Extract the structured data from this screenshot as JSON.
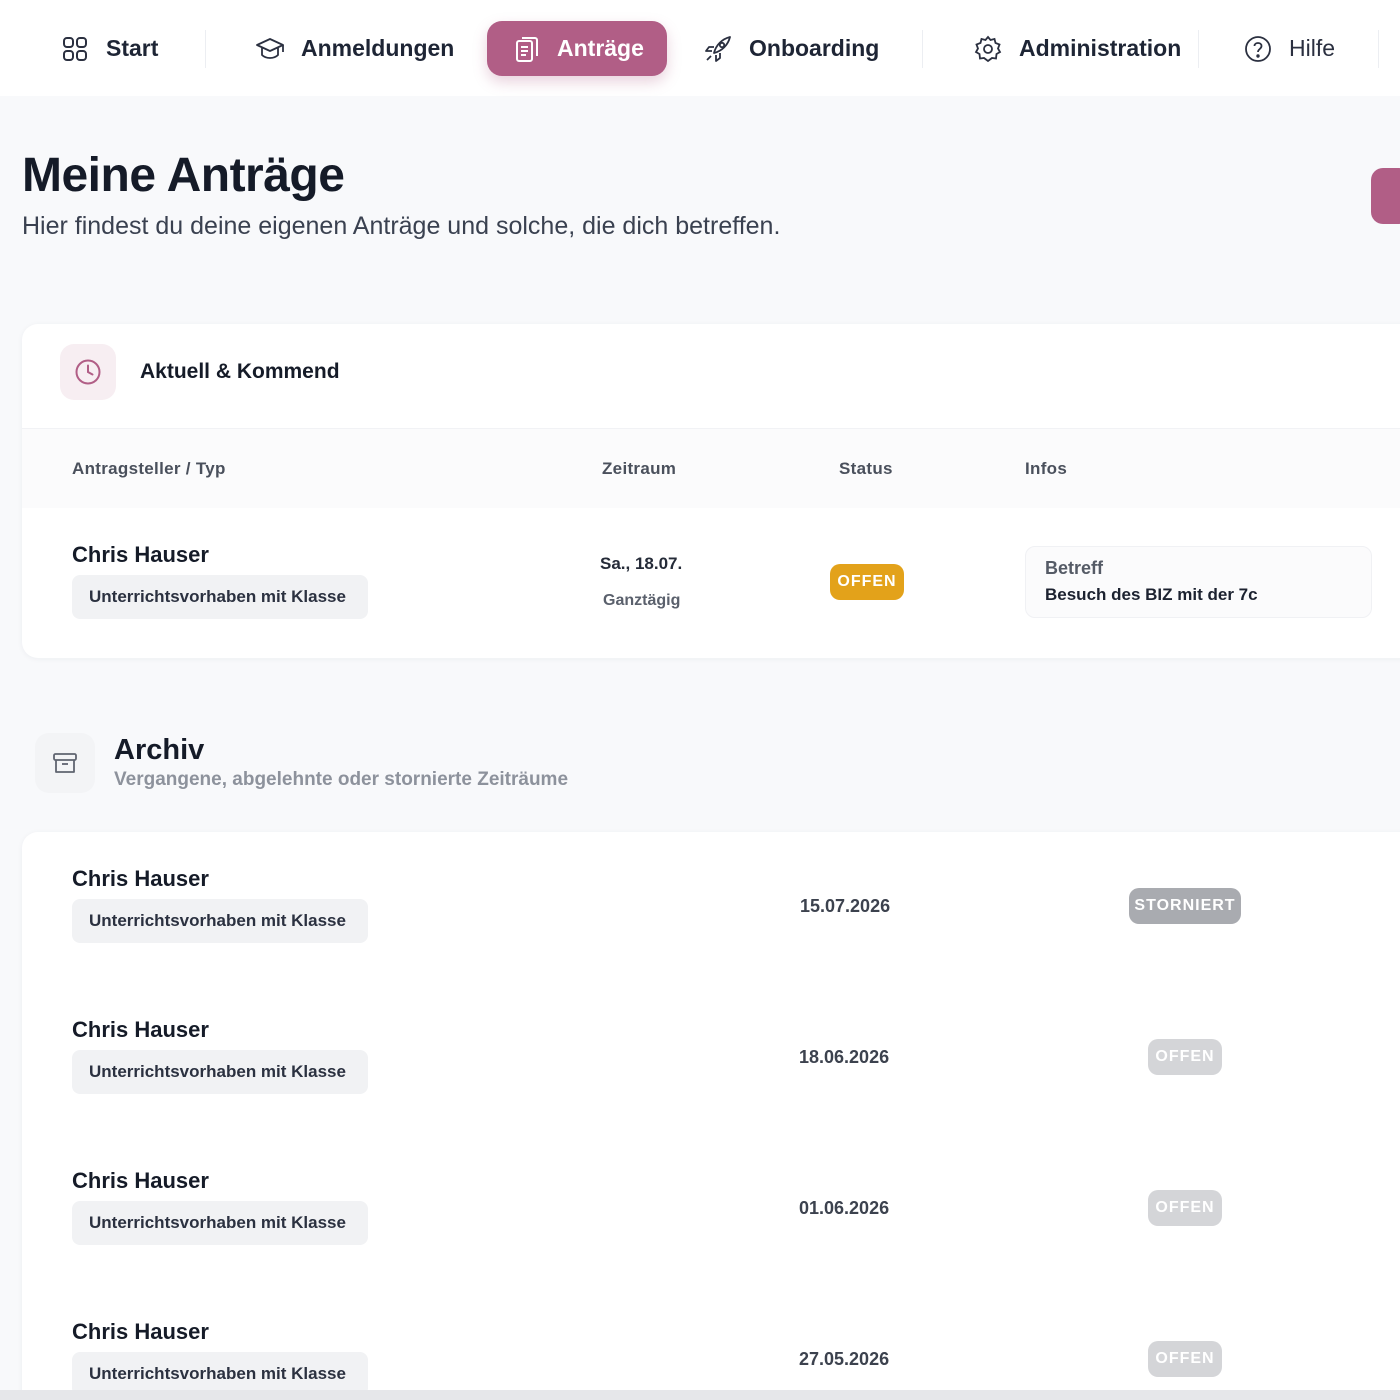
{
  "nav": {
    "items": [
      {
        "label": "Start",
        "icon": "grid-icon"
      },
      {
        "label": "Anmeldungen",
        "icon": "graduation-cap-icon"
      },
      {
        "label": "Anträge",
        "icon": "clipboard-icon"
      },
      {
        "label": "Onboarding",
        "icon": "rocket-icon"
      },
      {
        "label": "Administration",
        "icon": "gear-icon"
      },
      {
        "label": "Hilfe",
        "icon": "help-circle-icon"
      }
    ],
    "active_color": "#b15e86"
  },
  "header": {
    "title": "Meine Anträge",
    "subtitle": "Hier findest du deine eigenen Anträge und solche, die dich betreffen."
  },
  "current": {
    "title": "Aktuell & Kommend",
    "icon": "clock-icon",
    "columns": [
      "Antragsteller / Typ",
      "Zeitraum",
      "Status",
      "Infos"
    ],
    "rows": [
      {
        "name": "Chris Hauser",
        "type": "Unterrichtsvorhaben mit Klasse",
        "date": "Sa., 18.07.",
        "date_sub": "Ganztägig",
        "status": "OFFEN",
        "status_color": "#e3a21a",
        "info_label": "Betreff",
        "info_value": "Besuch des BIZ mit der 7c"
      }
    ]
  },
  "archive": {
    "title": "Archiv",
    "subtitle": "Vergangene, abgelehnte oder stornierte Zeiträume",
    "icon": "archive-box-icon",
    "rows": [
      {
        "name": "Chris Hauser",
        "type": "Unterrichtsvorhaben mit Klasse",
        "date": "15.07.2026",
        "status": "STORNIERT",
        "status_color": "#a9abb0"
      },
      {
        "name": "Chris Hauser",
        "type": "Unterrichtsvorhaben mit Klasse",
        "date": "18.06.2026",
        "status": "OFFEN",
        "status_color": "#d4d5d8"
      },
      {
        "name": "Chris Hauser",
        "type": "Unterrichtsvorhaben mit Klasse",
        "date": "01.06.2026",
        "status": "OFFEN",
        "status_color": "#d4d5d8"
      },
      {
        "name": "Chris Hauser",
        "type": "Unterrichtsvorhaben mit Klasse",
        "date": "27.05.2026",
        "status": "OFFEN",
        "status_color": "#d4d5d8"
      }
    ]
  }
}
